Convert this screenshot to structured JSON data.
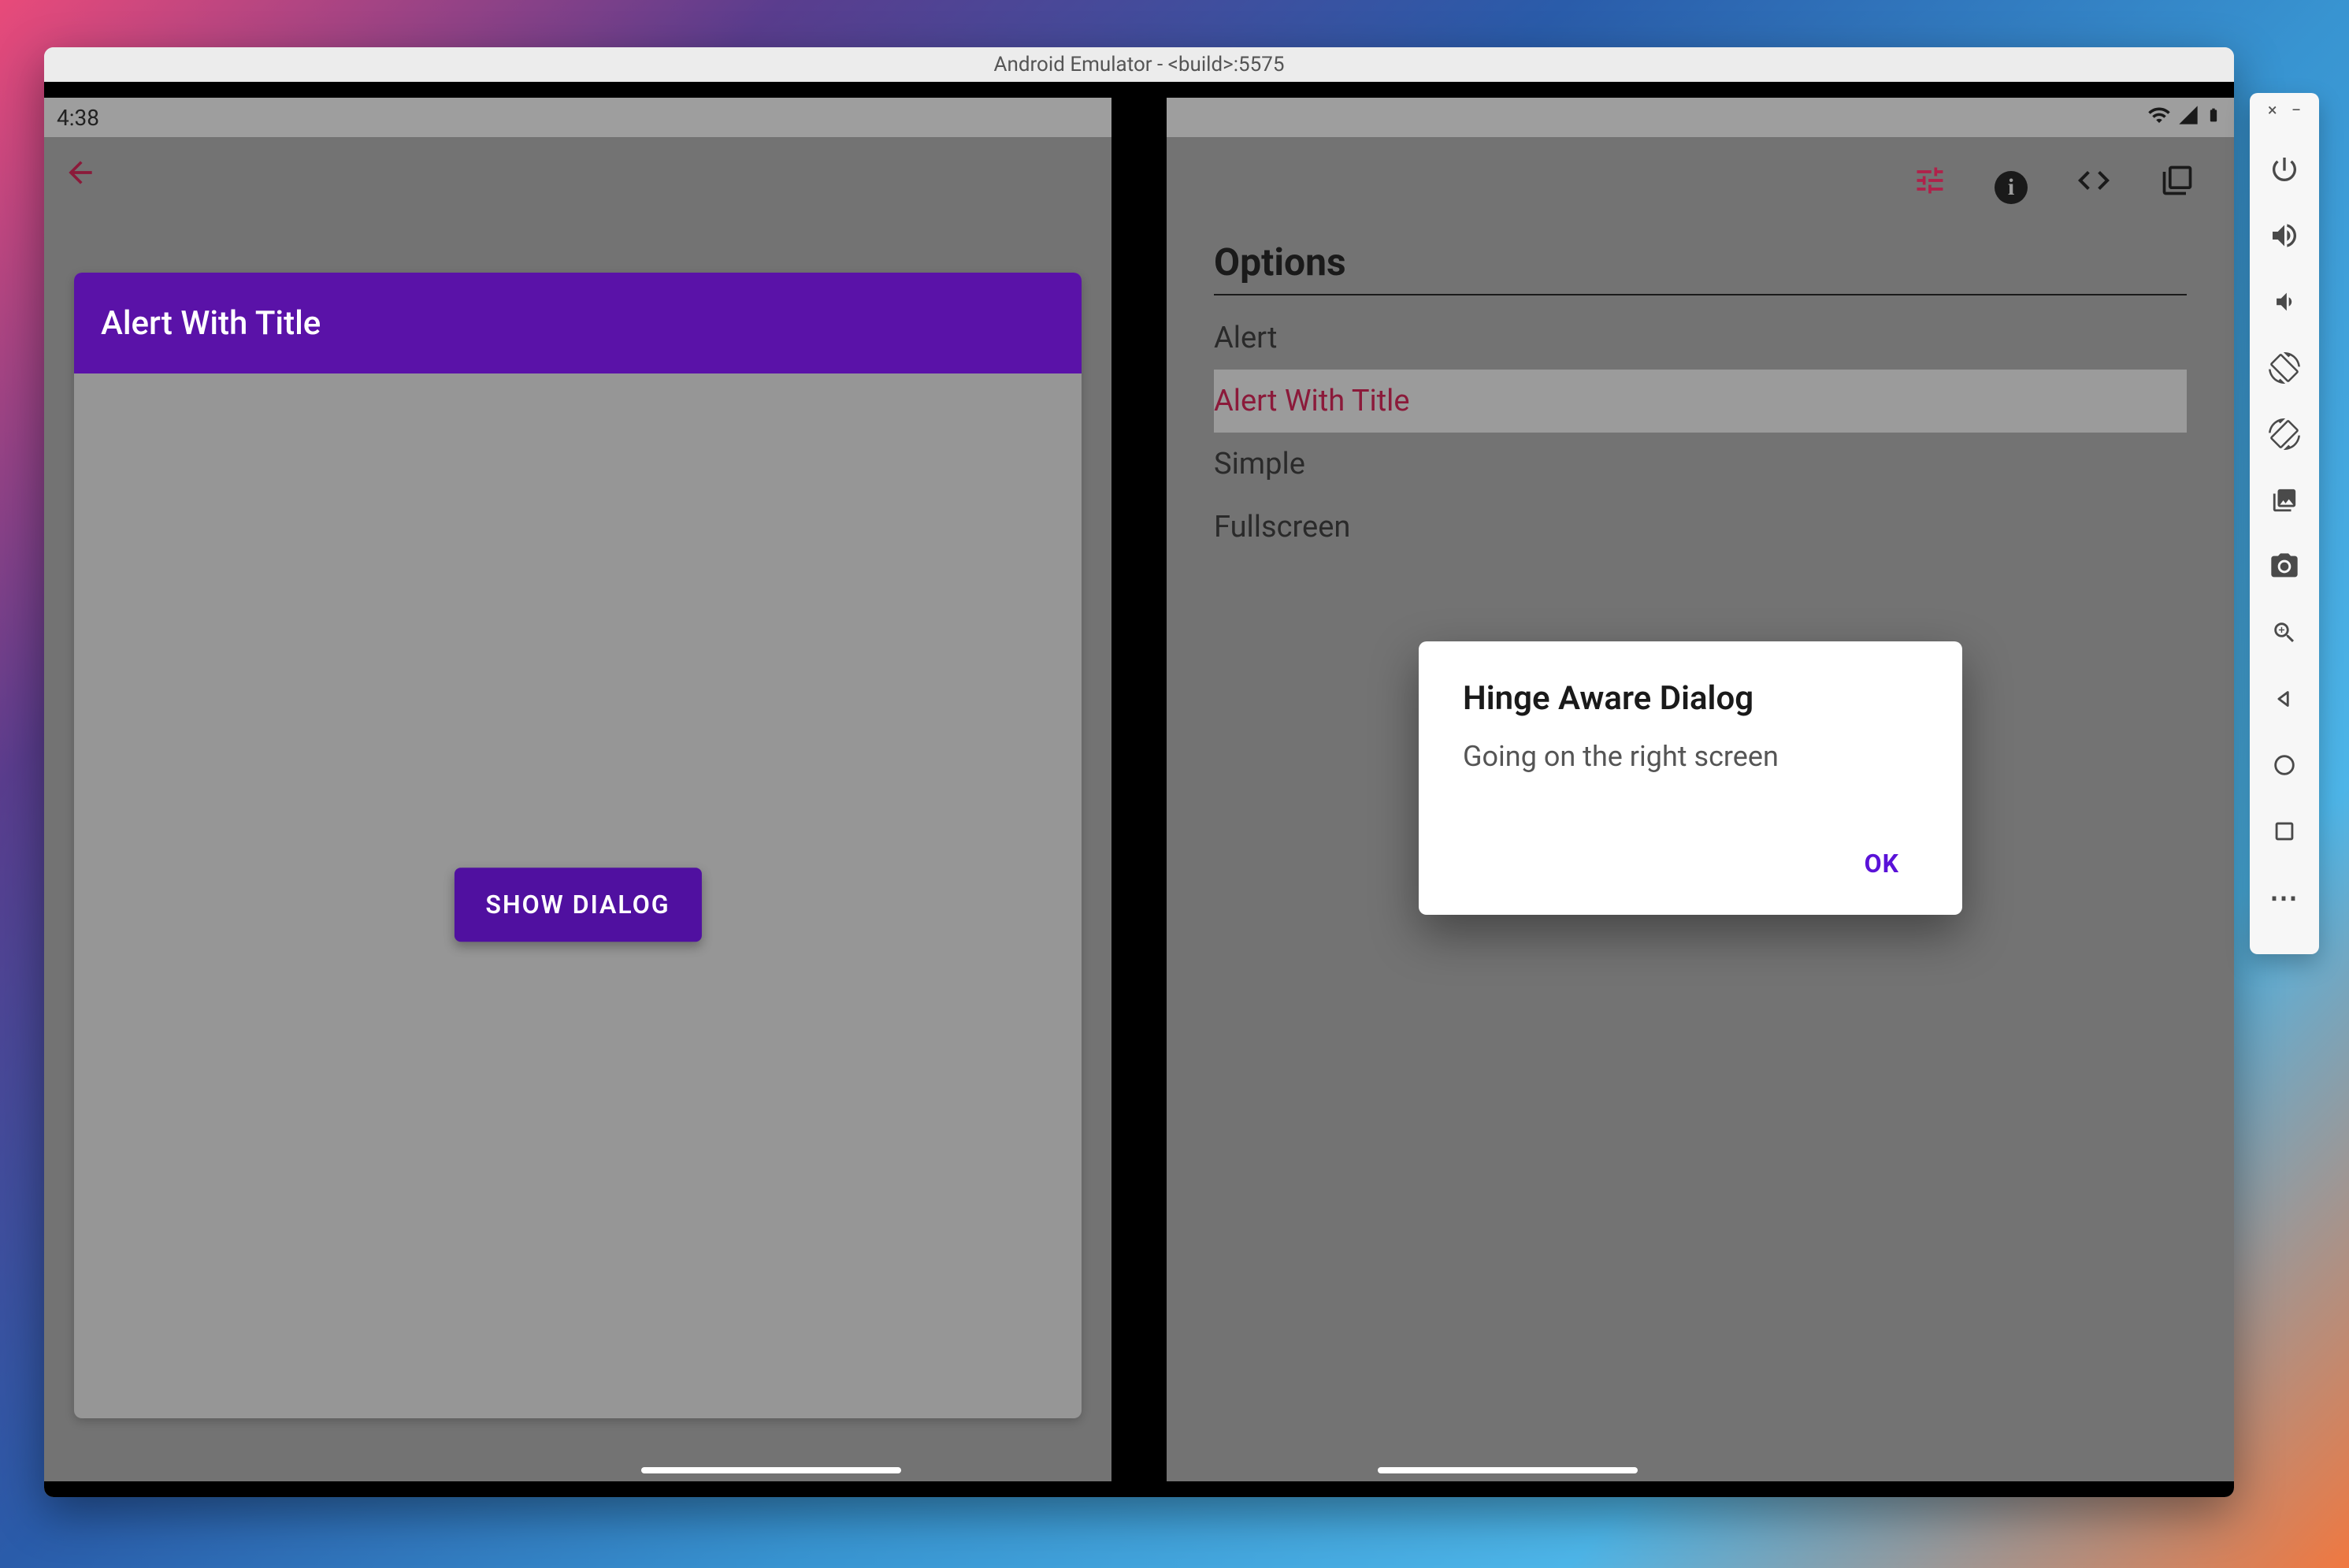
{
  "emulator": {
    "window_title": "Android Emulator - <build>:5575"
  },
  "status_bar": {
    "time": "4:38"
  },
  "left_pane": {
    "card_title": "Alert With Title",
    "show_dialog_label": "SHOW DIALOG"
  },
  "right_pane": {
    "options_title": "Options",
    "options": [
      {
        "label": "Alert",
        "selected": false
      },
      {
        "label": "Alert With Title",
        "selected": true
      },
      {
        "label": "Simple",
        "selected": false
      },
      {
        "label": "Fullscreen",
        "selected": false
      }
    ]
  },
  "dialog": {
    "title": "Hinge Aware Dialog",
    "body": "Going on the right screen",
    "ok_label": "OK"
  },
  "toolbar_icons": {
    "close": "×",
    "minimize": "−",
    "more": "⋯"
  }
}
